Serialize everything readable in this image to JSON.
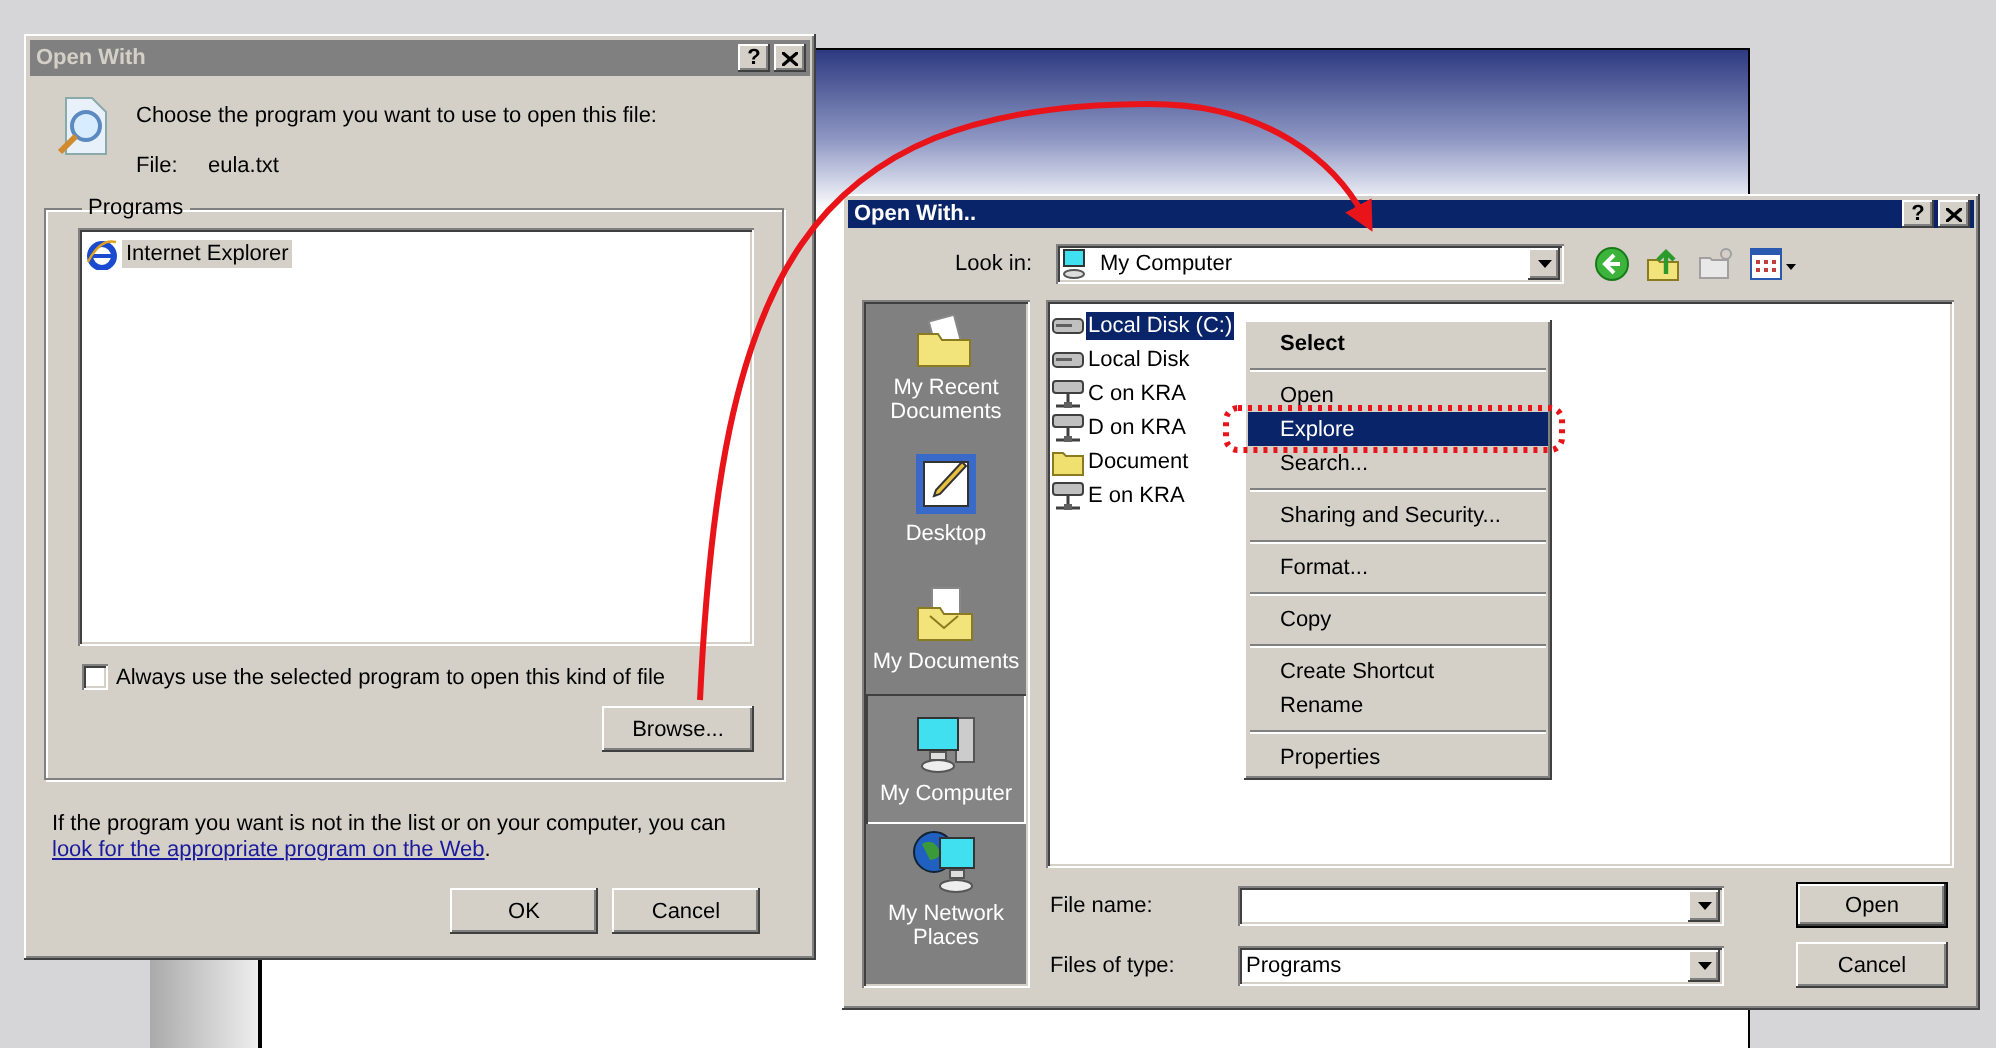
{
  "open_with_dialog": {
    "title": "Open With",
    "active": false,
    "help_button": "?",
    "prompt": "Choose the program you want to use to open this file:",
    "file_label": "File:",
    "file_name": "eula.txt",
    "programs_label": "Programs",
    "programs": [
      {
        "name": "Internet Explorer",
        "selected": true
      }
    ],
    "always_use": {
      "label": "Always use the selected program to open this kind of file",
      "checked": false
    },
    "browse_button": "Browse...",
    "info": {
      "text": "If the program you want is not in the list or on your computer, you can ",
      "link": "look for the appropriate program on the Web",
      "end": "."
    },
    "buttons": [
      {
        "label": "OK",
        "default": false
      },
      {
        "label": "Cancel",
        "default": false
      }
    ]
  },
  "browse_dialog": {
    "title": "Open With..",
    "active": true,
    "help_button": "?",
    "look_in_label": "Look in:",
    "look_in_value": "My Computer",
    "places": [
      {
        "label": "My Recent Documents",
        "kind": "recent",
        "selected": false
      },
      {
        "label": "Desktop",
        "kind": "desktop",
        "selected": false
      },
      {
        "label": "My Documents",
        "kind": "documents",
        "selected": false
      },
      {
        "label": "My Computer",
        "kind": "computer",
        "selected": true
      },
      {
        "label": "My Network Places",
        "kind": "network",
        "selected": false
      }
    ],
    "files": [
      {
        "name": "Local Disk (C:)",
        "kind": "drive",
        "selected": true
      },
      {
        "name": "Local Disk",
        "kind": "drive",
        "selected": false
      },
      {
        "name": "C on KRA",
        "kind": "network-drive",
        "selected": false
      },
      {
        "name": "D on KRA",
        "kind": "network-drive",
        "selected": false
      },
      {
        "name": "Document",
        "kind": "folder",
        "selected": false
      },
      {
        "name": "E on KRA",
        "kind": "network-drive",
        "selected": false
      }
    ],
    "file_name_label": "File name:",
    "file_type_label": "Files of type:",
    "file_type_value": "Programs",
    "buttons": [
      {
        "label": "Open",
        "default": true
      },
      {
        "label": "Cancel",
        "default": false
      }
    ]
  },
  "context_menu": {
    "items": [
      {
        "label": "Select",
        "kind": "default",
        "selected": false
      },
      {
        "kind": "separator"
      },
      {
        "label": "Open",
        "kind": "item",
        "selected": false
      },
      {
        "label": "Explore",
        "kind": "item",
        "selected": true
      },
      {
        "label": "Search...",
        "kind": "item",
        "selected": false
      },
      {
        "kind": "separator"
      },
      {
        "label": "Sharing and Security...",
        "kind": "item",
        "selected": false
      },
      {
        "kind": "separator"
      },
      {
        "label": "Format...",
        "kind": "item",
        "selected": false
      },
      {
        "kind": "separator"
      },
      {
        "label": "Copy",
        "kind": "item",
        "selected": false
      },
      {
        "kind": "separator"
      },
      {
        "label": "Create Shortcut",
        "kind": "item",
        "selected": false
      },
      {
        "label": "Rename",
        "kind": "item",
        "selected": false
      },
      {
        "kind": "separator"
      },
      {
        "label": "Properties",
        "kind": "item",
        "selected": false
      }
    ]
  }
}
